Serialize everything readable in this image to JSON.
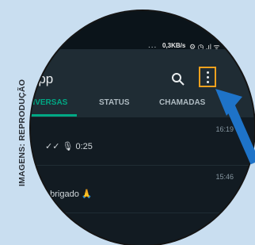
{
  "credit": "IMAGENS: REPRODUÇÃO",
  "status_bar": {
    "dots": "...",
    "network_speed": "0,3KB/s",
    "icons_text": "⚙ ◷ .ıl ᯤ"
  },
  "app_bar": {
    "title": "App",
    "search_icon": "search-icon",
    "menu_icon": "more-vert-icon",
    "highlight_color": "#f0a11e"
  },
  "tabs": [
    {
      "label": "NVERSAS",
      "active": true
    },
    {
      "label": "STATUS",
      "active": false
    },
    {
      "label": "CHAMADAS",
      "active": false
    }
  ],
  "chats": [
    {
      "time": "16:19",
      "preview": "✓✓ 🎙 0:25"
    },
    {
      "time": "15:46",
      "preview": "obrigado 🙏"
    }
  ],
  "colors": {
    "accent": "#00a884",
    "arrow": "#1e73c8",
    "background": "#c9def0"
  }
}
